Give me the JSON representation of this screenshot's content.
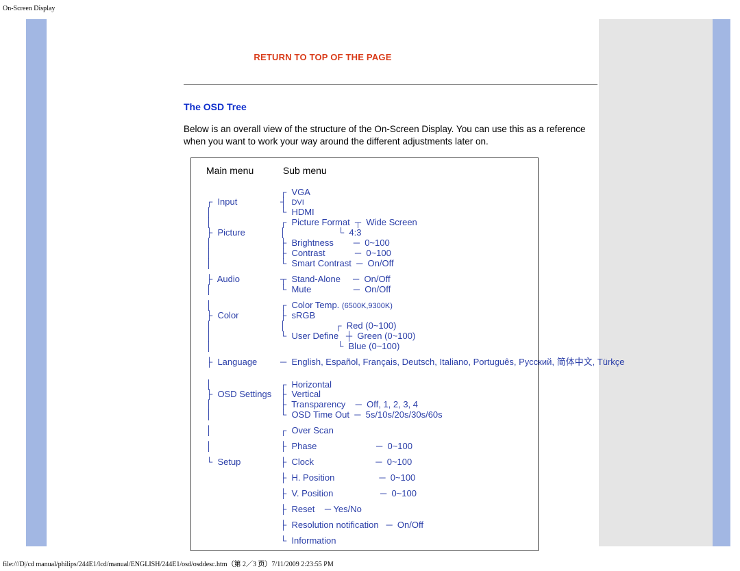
{
  "page_title": "On-Screen Display",
  "return_label": "RETURN TO TOP OF THE PAGE",
  "heading": "The OSD Tree",
  "intro": "Below is an overall view of the structure of the On-Screen Display. You can use this as a reference when you want to work your way around the different adjustments later on.",
  "diagram": {
    "main_header": "Main menu",
    "sub_header": "Sub menu",
    "input": {
      "label": "Input",
      "items": [
        "VGA",
        "DVI",
        "HDMI"
      ]
    },
    "picture": {
      "label": "Picture",
      "picture_format": {
        "label": "Picture Format",
        "values": [
          "Wide Screen",
          "4:3"
        ]
      },
      "brightness": {
        "label": "Brightness",
        "range": "0~100"
      },
      "contrast": {
        "label": "Contrast",
        "range": "0~100"
      },
      "smart_contrast": {
        "label": "Smart Contrast",
        "range": "On/Off"
      }
    },
    "audio": {
      "label": "Audio",
      "standalone": {
        "label": "Stand-Alone",
        "range": "On/Off"
      },
      "mute": {
        "label": "Mute",
        "range": "On/Off"
      }
    },
    "color": {
      "label": "Color",
      "color_temp": {
        "label": "Color Temp.",
        "detail": "(6500K,9300K)"
      },
      "srgb": "sRGB",
      "user_define": {
        "label": "User Define",
        "red": "Red (0~100)",
        "green": "Green (0~100)",
        "blue": "Blue (0~100)"
      }
    },
    "language": {
      "label": "Language",
      "value": "English, Español, Français, Deutsch, Italiano, Português, Русский, 简体中文, Türkçe"
    },
    "osd_settings": {
      "label": "OSD Settings",
      "horizontal": "Horizontal",
      "vertical": "Vertical",
      "transparency": {
        "label": "Transparency",
        "range": "Off, 1, 2, 3, 4"
      },
      "timeout": {
        "label": "OSD Time Out",
        "range": "5s/10s/20s/30s/60s"
      }
    },
    "setup": {
      "label": "Setup",
      "overscan": "Over Scan",
      "phase": {
        "label": "Phase",
        "range": "0~100"
      },
      "clock": {
        "label": "Clock",
        "range": "0~100"
      },
      "hpos": {
        "label": "H. Position",
        "range": "0~100"
      },
      "vpos": {
        "label": "V. Position",
        "range": "0~100"
      },
      "reset": {
        "label": "Reset",
        "range": "Yes/No"
      },
      "resnotif": {
        "label": "Resolution notification",
        "range": "On/Off"
      },
      "information": "Information"
    }
  },
  "footer": "file:///D|/cd manual/philips/244E1/lcd/manual/ENGLISH/244E1/osd/osddesc.htm（第 2／3 页）7/11/2009 2:23:55 PM"
}
